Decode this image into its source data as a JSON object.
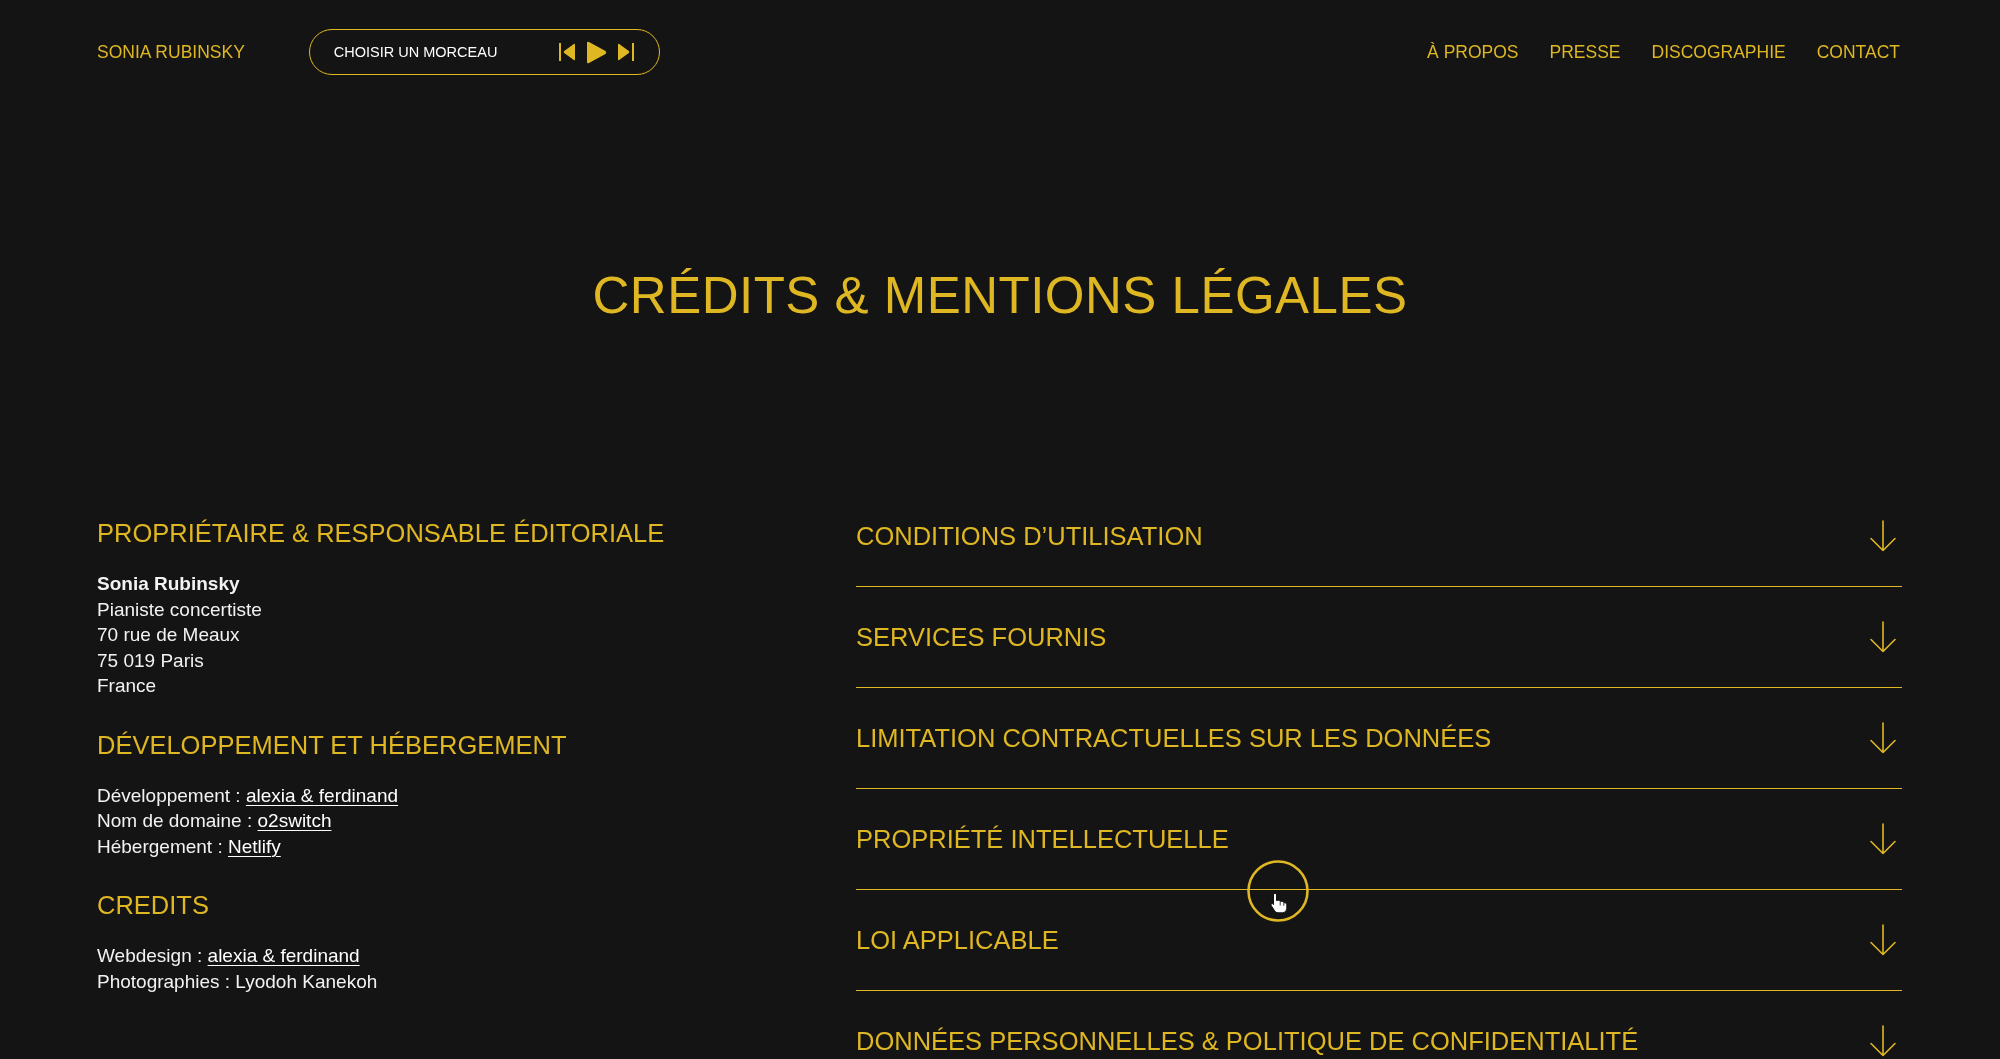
{
  "header": {
    "logo": "SONIA RUBINSKY",
    "player": {
      "track_prompt": "CHOISIR UN MORCEAU"
    },
    "nav": [
      "À PROPOS",
      "PRESSE",
      "DISCOGRAPHIE",
      "CONTACT"
    ]
  },
  "page_title": "CRÉDITS & MENTIONS LÉGALES",
  "sections": [
    {
      "heading": "PROPRIÉTAIRE & RESPONSABLE ÉDITORIALE",
      "lines": [
        {
          "kind": "name",
          "text": "Sonia Rubinsky"
        },
        {
          "kind": "text",
          "text": "Pianiste concertiste"
        },
        {
          "kind": "text",
          "text": "70 rue de Meaux"
        },
        {
          "kind": "text",
          "text": "75 019 Paris"
        },
        {
          "kind": "text",
          "text": "France"
        }
      ]
    },
    {
      "heading": "DÉVELOPPEMENT ET HÉBERGEMENT",
      "lines": [
        {
          "kind": "link",
          "label": "Développement :",
          "link": "alexia & ferdinand"
        },
        {
          "kind": "link",
          "label": "Nom de domaine :",
          "link": "o2switch"
        },
        {
          "kind": "link",
          "label": "Hébergement :",
          "link": "Netlify"
        }
      ]
    },
    {
      "heading": "CREDITS",
      "lines": [
        {
          "kind": "link",
          "label": "Webdesign :",
          "link": "alexia & ferdinand"
        },
        {
          "kind": "text",
          "text": "Photographies : Lyodoh Kanekoh"
        }
      ]
    }
  ],
  "accordion": [
    {
      "title": "CONDITIONS D’UTILISATION",
      "expanded": false
    },
    {
      "title": "SERVICES FOURNIS",
      "expanded": false
    },
    {
      "title": "LIMITATION CONTRACTUELLES SUR LES DONNÉES",
      "expanded": false
    },
    {
      "title": "PROPRIÉTÉ INTELLECTUELLE",
      "expanded": false
    },
    {
      "title": "LOI APPLICABLE",
      "expanded": false
    },
    {
      "title": "DONNÉES PERSONNELLES & POLITIQUE DE CONFIDENTIALITÉ",
      "expanded": false
    }
  ]
}
